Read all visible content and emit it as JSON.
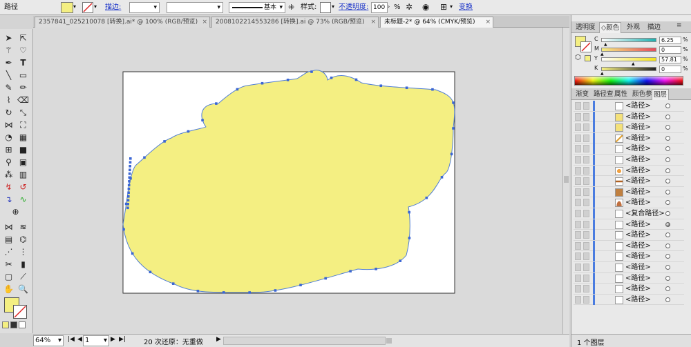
{
  "control_bar": {
    "selection_label": "路径",
    "fill_color": "#f4ef82",
    "stroke_label": "描边:",
    "stroke_weight_value": "",
    "brush_value": "",
    "profile_label": "基本",
    "style_label": "样式:",
    "opacity_label": "不透明度:",
    "opacity_value": "100",
    "opacity_unit": "%",
    "transform_label": "变换"
  },
  "doc_tabs": [
    {
      "label": "2357841_025210078 [转换].ai* @ 100% (RGB/预览)",
      "active": false
    },
    {
      "label": "2008102214553286 [转换].ai @ 73% (RGB/预览)",
      "active": false
    },
    {
      "label": "未标题-2* @ 64% (CMYK/预览)",
      "active": true
    }
  ],
  "tab_close": "×",
  "status_bar": {
    "zoom": "64%",
    "page": "1",
    "undo_info": "20 次还原：无重做"
  },
  "color_panel": {
    "tabs": [
      "透明度",
      "◇颜色",
      "外观",
      "描边"
    ],
    "fill_color": "#f4ef82",
    "channels": [
      {
        "label": "C",
        "value": "6.25",
        "unit": "%"
      },
      {
        "label": "M",
        "value": "0",
        "unit": "%"
      },
      {
        "label": "Y",
        "value": "57.81",
        "unit": "%"
      },
      {
        "label": "K",
        "value": "0",
        "unit": "%"
      }
    ]
  },
  "layers_panel": {
    "tabs": [
      "渐变",
      "路径查",
      "属性",
      "颜色参",
      "图层"
    ],
    "footer": "1 个图层",
    "items": [
      {
        "name": "<路径>",
        "thumb": "blank",
        "target": "empty"
      },
      {
        "name": "<路径>",
        "thumb": "yellow",
        "target": "empty"
      },
      {
        "name": "<路径>",
        "thumb": "yellow",
        "target": "empty"
      },
      {
        "name": "<路径>",
        "thumb": "slash",
        "target": "empty"
      },
      {
        "name": "<路径>",
        "thumb": "blank",
        "target": "empty"
      },
      {
        "name": "<路径>",
        "thumb": "blank",
        "target": "empty"
      },
      {
        "name": "<路径>",
        "thumb": "orange",
        "target": "empty"
      },
      {
        "name": "<路径>",
        "thumb": "stripe",
        "target": "empty"
      },
      {
        "name": "<路径>",
        "thumb": "brown",
        "target": "empty"
      },
      {
        "name": "<路径>",
        "thumb": "arch",
        "target": "empty"
      },
      {
        "name": "<复合路径>",
        "thumb": "blank",
        "target": "empty"
      },
      {
        "name": "<路径>",
        "thumb": "blank",
        "target": "filled"
      },
      {
        "name": "<路径>",
        "thumb": "blank",
        "target": "empty"
      },
      {
        "name": "<路径>",
        "thumb": "blank",
        "target": "empty"
      },
      {
        "name": "<路径>",
        "thumb": "blank",
        "target": "empty"
      },
      {
        "name": "<路径>",
        "thumb": "blank",
        "target": "empty"
      },
      {
        "name": "<路径>",
        "thumb": "blank",
        "target": "empty"
      },
      {
        "name": "<路径>",
        "thumb": "blank",
        "target": "empty"
      },
      {
        "name": "<路径>",
        "thumb": "blank",
        "target": "empty"
      }
    ]
  },
  "colors": {
    "shape_fill": "#f4ef82",
    "path_stroke": "#4f7dd6",
    "anchor": "#3b66d4"
  }
}
